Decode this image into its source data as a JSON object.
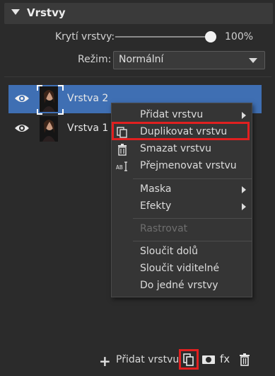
{
  "panel": {
    "title": "Vrstvy"
  },
  "opacity": {
    "label": "Krytí vrstvy:",
    "value": "100%",
    "level": 1.0
  },
  "mode": {
    "label": "Režim:",
    "value": "Normální"
  },
  "layers": [
    {
      "name": "Vrstva 2",
      "selected": true
    },
    {
      "name": "Vrstva 1",
      "selected": false
    }
  ],
  "context_menu": {
    "items": [
      {
        "label": "Přidat vrstvu",
        "icon": "",
        "submenu": true
      },
      {
        "label": "Duplikovat vrstvu",
        "icon": "duplicate-icon",
        "highlighted": true
      },
      {
        "label": "Smazat vrstvu",
        "icon": "trash-icon"
      },
      {
        "label": "Přejmenovat vrstvu",
        "icon": "rename-icon"
      },
      {
        "label": "Maska",
        "submenu": true
      },
      {
        "label": "Efekty",
        "submenu": true
      },
      {
        "label": "Rastrovat",
        "disabled": true
      },
      {
        "label": "Sloučit dolů"
      },
      {
        "label": "Sloučit viditelné"
      },
      {
        "label": "Do jedné vrstvy"
      }
    ]
  },
  "toolbar": {
    "add_label": "Přidat vrstvu",
    "fx_label": "fx"
  },
  "colors": {
    "accent": "#3f6fb3",
    "highlight": "#e02020",
    "panel": "#2b2b2b"
  }
}
